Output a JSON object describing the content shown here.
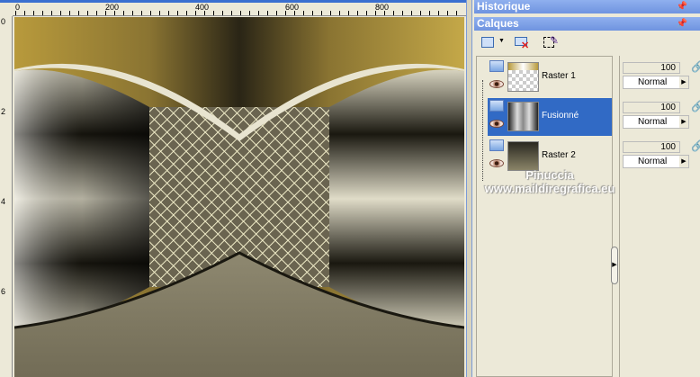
{
  "rulers": {
    "horizontal": [
      "0",
      "200",
      "400",
      "600",
      "800"
    ],
    "vertical": [
      "0",
      "2",
      "4",
      "6"
    ]
  },
  "panels": {
    "history_title": "Historique",
    "layers_title": "Calques"
  },
  "toolbar": {
    "items": [
      {
        "icon": "new-layer-icon"
      },
      {
        "icon": "delete-layer-icon"
      },
      {
        "icon": "edit-selection-icon"
      }
    ]
  },
  "layers": [
    {
      "name": "Raster 1",
      "opacity": "100",
      "blend": "Normal",
      "selected": false
    },
    {
      "name": "Fusionné",
      "opacity": "100",
      "blend": "Normal",
      "selected": true
    },
    {
      "name": "Raster 2",
      "opacity": "100",
      "blend": "Normal",
      "selected": false
    }
  ],
  "watermark": {
    "line1": "Pinuccia",
    "line2": "www.maildiregrafica.eu"
  },
  "colors": {
    "selection": "#316ac5",
    "panel_header": "#7b9be3",
    "gold": "#b8a040"
  }
}
